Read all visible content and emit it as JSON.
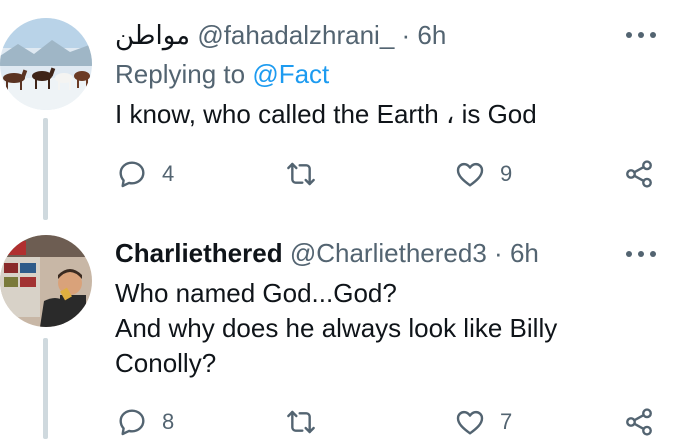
{
  "tweets": [
    {
      "display_name": "مواطن",
      "handle": "@fahadalzhrani_",
      "separator": "·",
      "time": "6h",
      "replying_prefix": "Replying to ",
      "replying_to": "@Fact",
      "lines": [
        "I know, who called the Earth ، is God"
      ],
      "stats": {
        "replies": "4",
        "retweets": "",
        "likes": "9"
      }
    },
    {
      "display_name": "Charliethered",
      "handle": "@Charliethered3",
      "separator": "·",
      "time": "6h",
      "lines": [
        "Who named God...God?",
        "And why does he always look like Billy",
        "Conolly?"
      ],
      "stats": {
        "replies": "8",
        "retweets": "",
        "likes": "7"
      }
    }
  ],
  "colors": {
    "text": "#0f1419",
    "secondary": "#536471",
    "link": "#1d9bf0",
    "thread_line": "#cfd9de"
  }
}
